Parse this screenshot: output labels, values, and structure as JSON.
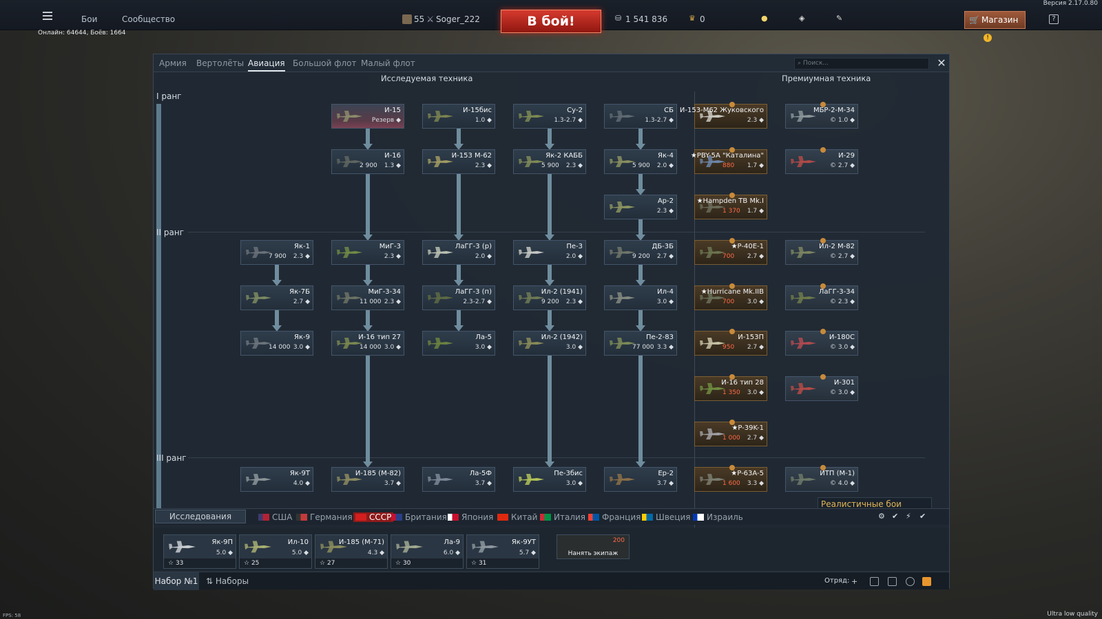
{
  "top": {
    "version": "Версия 2.17.0.80",
    "menu": [
      "Бои",
      "Сообщество"
    ],
    "online": "Онлайн: 64644, Боёв: 1664",
    "level": "55",
    "nickname": "Soger_222",
    "to_battle": "В бой!",
    "silver": "1 541 836",
    "gold": "0",
    "shop": "Магазин",
    "help": "?"
  },
  "tabs": [
    "Армия",
    "Вертолёты",
    "Авиация",
    "Большой флот",
    "Малый флот"
  ],
  "active_tab": "Авиация",
  "search_placeholder": "Поиск...",
  "headers": {
    "researchable": "Исследуемая техника",
    "premium": "Премиумная техника"
  },
  "ranks": [
    "I ранг",
    "II ранг",
    "III ранг"
  ],
  "vehicles": [
    {
      "name": "И-15",
      "br": "Резерв ◆",
      "cost": "",
      "kind": "reserve",
      "color": "#8a8c6a"
    },
    {
      "name": "И-15бис",
      "br": "1.0 ◆",
      "cost": "",
      "kind": "normal",
      "color": "#7a8250"
    },
    {
      "name": "Су-2",
      "br": "1.3-2.7 ◆",
      "cost": "",
      "kind": "normal",
      "color": "#7c8a52"
    },
    {
      "name": "СБ",
      "br": "1.3-2.7 ◆",
      "cost": "",
      "kind": "normal",
      "color": "#5f6a72"
    },
    {
      "name": "И-16",
      "br": "1.3 ◆",
      "cost": "2 900",
      "kind": "normal",
      "color": "#5f6660"
    },
    {
      "name": "И-153 М-62",
      "br": "2.3 ◆",
      "cost": "",
      "kind": "normal",
      "color": "#a09a62"
    },
    {
      "name": "Як-2 КАББ",
      "br": "2.3 ◆",
      "cost": "5 900",
      "kind": "normal",
      "color": "#7f8958"
    },
    {
      "name": "Як-4",
      "br": "2.0 ◆",
      "cost": "5 900",
      "kind": "normal",
      "color": "#8a9060"
    },
    {
      "name": "Ар-2",
      "br": "2.3 ◆",
      "cost": "",
      "kind": "normal",
      "color": "#8c9560"
    },
    {
      "name": "Як-1",
      "br": "2.3 ◆",
      "cost": "7 900",
      "kind": "normal",
      "color": "#6a7078"
    },
    {
      "name": "МиГ-3",
      "br": "2.3 ◆",
      "cost": "",
      "kind": "normal",
      "color": "#6f8a44"
    },
    {
      "name": "ЛаГГ-3 (р)",
      "br": "2.0 ◆",
      "cost": "",
      "kind": "normal",
      "color": "#b8bfb0"
    },
    {
      "name": "Пе-3",
      "br": "2.0 ◆",
      "cost": "",
      "kind": "normal",
      "color": "#c3c7c2"
    },
    {
      "name": "ДБ-3Б",
      "br": "2.7 ◆",
      "cost": "9 200",
      "kind": "normal",
      "color": "#70766a"
    },
    {
      "name": "Як-7Б",
      "br": "2.7 ◆",
      "cost": "",
      "kind": "normal",
      "color": "#7c8a62"
    },
    {
      "name": "МиГ-3-34",
      "br": "2.3 ◆",
      "cost": "11 000",
      "kind": "normal",
      "color": "#6c7264"
    },
    {
      "name": "ЛаГГ-3 (п)",
      "br": "2.3-2.7 ◆",
      "cost": "",
      "kind": "normal",
      "color": "#5d6a44"
    },
    {
      "name": "Ил-2 (1941)",
      "br": "2.3 ◆",
      "cost": "9 200",
      "kind": "normal",
      "color": "#6f7a55"
    },
    {
      "name": "Ил-4",
      "br": "3.0 ◆",
      "cost": "",
      "kind": "normal",
      "color": "#848a80"
    },
    {
      "name": "Як-9",
      "br": "3.0 ◆",
      "cost": "14 000",
      "kind": "normal",
      "color": "#6c747c"
    },
    {
      "name": "И-16 тип 27",
      "br": "3.0 ◆",
      "cost": "14 000",
      "kind": "normal",
      "color": "#7a8850"
    },
    {
      "name": "Ла-5",
      "br": "3.0 ◆",
      "cost": "",
      "kind": "normal",
      "color": "#6b8240"
    },
    {
      "name": "Ил-2 (1942)",
      "br": "3.0 ◆",
      "cost": "",
      "kind": "normal",
      "color": "#8a8a58"
    },
    {
      "name": "Пе-2-83",
      "br": "3.3 ◆",
      "cost": "77 000",
      "kind": "normal",
      "color": "#7c8a58"
    },
    {
      "name": "Як-9Т",
      "br": "4.0 ◆",
      "cost": "",
      "kind": "normal",
      "color": "#8a9498"
    },
    {
      "name": "И-185 (М-82)",
      "br": "3.7 ◆",
      "cost": "",
      "kind": "normal",
      "color": "#8c8a60"
    },
    {
      "name": "Ла-5Ф",
      "br": "3.7 ◆",
      "cost": "",
      "kind": "normal",
      "color": "#7d8896"
    },
    {
      "name": "Пе-3бис",
      "br": "3.0 ◆",
      "cost": "",
      "kind": "normal",
      "color": "#b2c258"
    },
    {
      "name": "Ер-2",
      "br": "3.7 ◆",
      "cost": "",
      "kind": "normal",
      "color": "#8b6e48"
    }
  ],
  "premium": [
    {
      "name": "И-153-М62 Жуковского",
      "br": "2.3 ◆",
      "cost": "",
      "kind": "premium",
      "color": "#c9c8c0"
    },
    {
      "name": "МБР-2-М-34",
      "br": "© 1.0 ◆",
      "cost": "",
      "kind": "prem2",
      "color": "#8a9698"
    },
    {
      "name": "★PBY-5A \"Каталина\"",
      "br": "1.7 ◆",
      "cost": "880",
      "kind": "premium",
      "color": "#6d86a8"
    },
    {
      "name": "И-29",
      "br": "© 2.7 ◆",
      "cost": "",
      "kind": "prem2",
      "color": "#b04a48"
    },
    {
      "name": "★Hampden TB Mk.I",
      "br": "1.7 ◆",
      "cost": "1 370",
      "kind": "premium",
      "color": "#6a6b58"
    },
    {
      "name": "★P-40E-1",
      "br": "2.7 ◆",
      "cost": "700",
      "kind": "premium",
      "color": "#6c7450"
    },
    {
      "name": "Ил-2 М-82",
      "br": "© 2.7 ◆",
      "cost": "",
      "kind": "prem2",
      "color": "#7c8460"
    },
    {
      "name": "★Hurricane Mk.IIB",
      "br": "3.0 ◆",
      "cost": "700",
      "kind": "premium",
      "color": "#6a7058"
    },
    {
      "name": "ЛаГГ-3-34",
      "br": "© 2.3 ◆",
      "cost": "",
      "kind": "prem2",
      "color": "#6e7a4a"
    },
    {
      "name": "И-153П",
      "br": "2.7 ◆",
      "cost": "950",
      "kind": "premium",
      "color": "#c6c2a6"
    },
    {
      "name": "И-180С",
      "br": "© 3.0 ◆",
      "cost": "",
      "kind": "prem2",
      "color": "#b04a50"
    },
    {
      "name": "И-16 тип 28",
      "br": "3.0 ◆",
      "cost": "1 350",
      "kind": "premium",
      "color": "#6f8c40"
    },
    {
      "name": "И-301",
      "br": "© 3.0 ◆",
      "cost": "",
      "kind": "prem2",
      "color": "#b44a46"
    },
    {
      "name": "★P-39K-1",
      "br": "2.7 ◆",
      "cost": "1 000",
      "kind": "premium",
      "color": "#a0a0a4"
    },
    {
      "name": "★P-63A-5",
      "br": "3.3 ◆",
      "cost": "1 600",
      "kind": "premium",
      "color": "#7a7c70"
    },
    {
      "name": "ИТП (М-1)",
      "br": "© 4.0 ◆",
      "cost": "",
      "kind": "prem2",
      "color": "#6c7868"
    }
  ],
  "game_mode": "Реалистичные бои",
  "research_button": "Исследования",
  "nations": [
    {
      "name": "США",
      "c1": "#b22234",
      "c2": "#3c3b6e"
    },
    {
      "name": "Германия",
      "c1": "#c43a3a",
      "c2": "#333"
    },
    {
      "name": "СССР",
      "c1": "#d31f1f",
      "c2": "#d31f1f"
    },
    {
      "name": "Британия",
      "c1": "#2a3f8a",
      "c2": "#c8102e"
    },
    {
      "name": "Япония",
      "c1": "#c8102e",
      "c2": "#ffffff"
    },
    {
      "name": "Китай",
      "c1": "#de2910",
      "c2": "#de2910"
    },
    {
      "name": "Италия",
      "c1": "#009246",
      "c2": "#ce2b37"
    },
    {
      "name": "Франция",
      "c1": "#0055a4",
      "c2": "#ef4135"
    },
    {
      "name": "Швеция",
      "c1": "#006aa7",
      "c2": "#fecc00"
    },
    {
      "name": "Израиль",
      "c1": "#ffffff",
      "c2": "#0038b8"
    }
  ],
  "crew_slots": [
    {
      "name": "Як-9П",
      "br": "5.0 ◆",
      "crew": "33",
      "color": "#c8ccd0"
    },
    {
      "name": "Ил-10",
      "br": "5.0 ◆",
      "crew": "25",
      "color": "#a7ae72"
    },
    {
      "name": "И-185 (М-71)",
      "br": "4.3 ◆",
      "crew": "27",
      "color": "#8a8c5c"
    },
    {
      "name": "Ла-9",
      "br": "6.0 ◆",
      "crew": "30",
      "color": "#a0a890"
    },
    {
      "name": "Як-9УТ",
      "br": "5.7 ◆",
      "crew": "31",
      "color": "#8c969e"
    }
  ],
  "hire": {
    "label": "Нанять экипаж",
    "cost": "200"
  },
  "bottom": {
    "preset": "Набор №1",
    "presets": "Наборы",
    "squad": "Отряд:"
  },
  "fps": "FPS: 58",
  "quality": "Ultra low quality"
}
